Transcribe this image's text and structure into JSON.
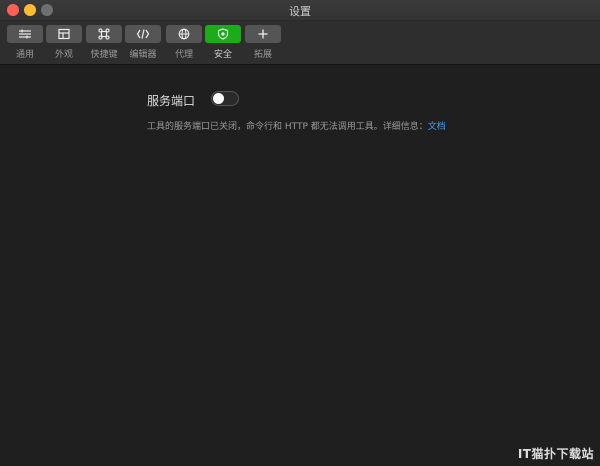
{
  "window": {
    "title": "设置"
  },
  "toolbar": {
    "items": [
      {
        "label": "通用",
        "icon": "sliders-icon"
      },
      {
        "label": "外观",
        "icon": "layout-icon"
      },
      {
        "label": "快捷键",
        "icon": "command-icon"
      },
      {
        "label": "编辑器",
        "icon": "code-icon"
      },
      {
        "label": "代理",
        "icon": "globe-icon"
      },
      {
        "label": "安全",
        "icon": "shield-icon",
        "active": true
      },
      {
        "label": "拓展",
        "icon": "plus-icon"
      }
    ],
    "active_color": "#1aad19"
  },
  "security": {
    "service_port_label": "服务端口",
    "service_port_enabled": false,
    "description": "工具的服务端口已关闭，命令行和 HTTP 都无法调用工具。详细信息：",
    "doc_link": "文档"
  },
  "watermark": "IT猫扑下载站"
}
